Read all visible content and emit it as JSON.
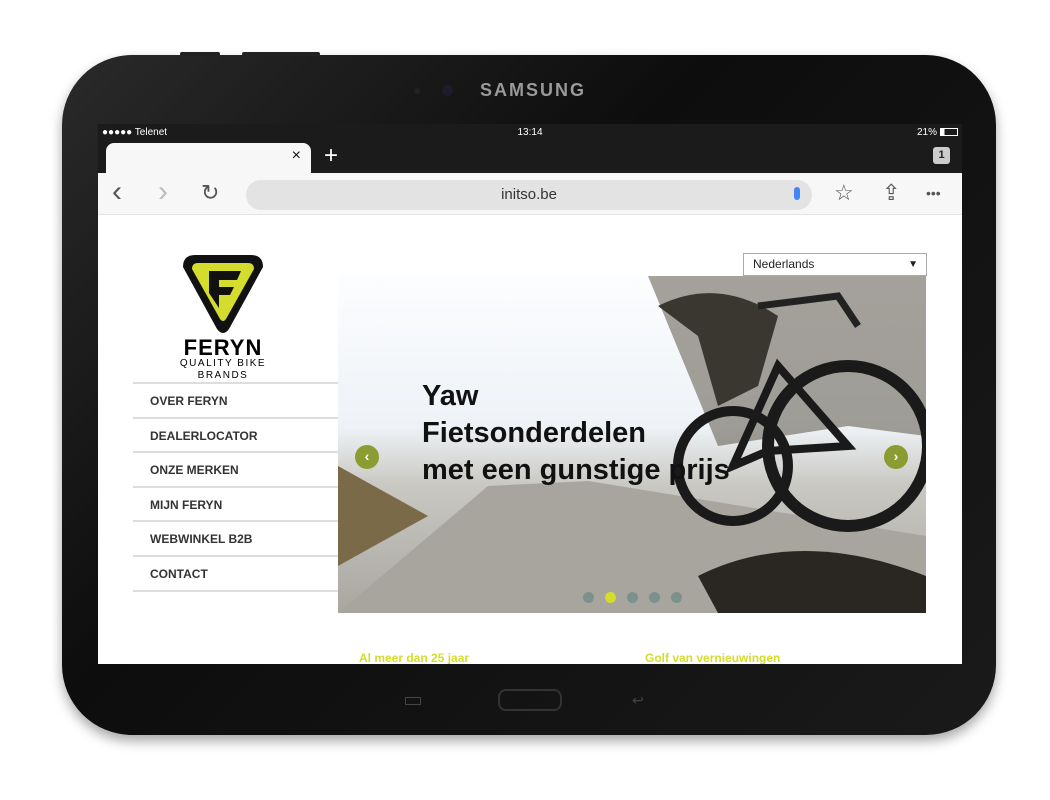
{
  "device": {
    "brand": "SAMSUNG"
  },
  "status_bar": {
    "carrier": "●●●●● Telenet",
    "time": "13:14",
    "battery": "21%"
  },
  "browser": {
    "tab_close": "×",
    "new_tab": "+",
    "tab_count": "1",
    "url": "initso.be",
    "back": "‹",
    "forward": "›",
    "reload": "↻",
    "bookmark": "☆",
    "share": "⇪",
    "more": "•••"
  },
  "site": {
    "logo": {
      "name": "FERYN",
      "tagline_1": "QUALITY BIKE",
      "tagline_2": "BRANDS"
    },
    "language": "Nederlands",
    "nav": [
      "OVER FERYN",
      "DEALERLOCATOR",
      "ONZE MERKEN",
      "MIJN FERYN",
      "WEBWINKEL B2B",
      "CONTACT"
    ],
    "slider": {
      "headline": [
        "Yaw",
        "Fietsonderdelen",
        "met een gunstige prijs"
      ],
      "prev": "‹",
      "next": "›",
      "active_slide": 2,
      "slide_count": 5
    },
    "sections": [
      "Al meer dan 25 jaar",
      "Golf van vernieuwingen"
    ],
    "accent": "#d4dc2e"
  }
}
